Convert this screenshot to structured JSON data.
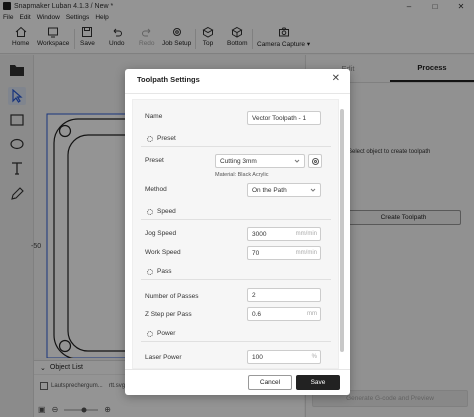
{
  "window": {
    "title": "Snapmaker Luban 4.1.3 / New *",
    "icon": "luban-logo-icon"
  },
  "menu": {
    "items": [
      "File",
      "Edit",
      "Window",
      "Settings",
      "Help"
    ]
  },
  "toolbar": {
    "home": "Home",
    "workspace": "Workspace",
    "save": "Save",
    "undo": "Undo",
    "redo": "Redo",
    "job_setup": "Job Setup",
    "top": "Top",
    "bottom": "Bottom",
    "camera_capture": "Camera Capture"
  },
  "canvas": {
    "axis_label": "-50"
  },
  "object_list": {
    "header": "Object List",
    "items": [
      {
        "name": "Lautsprechergum...",
        "ext": "rtt.svg"
      }
    ]
  },
  "right_panel": {
    "tabs": [
      "Edit",
      "Process"
    ],
    "active_tab": "Process",
    "select_hint": "Select object to create toolpath",
    "create_toolpath": "Create Toolpath",
    "generate_button": "Generate G-code and Preview"
  },
  "dialog": {
    "title": "Toolpath Settings",
    "name_label": "Name",
    "name_value": "Vector Toolpath - 1",
    "preset_section": "Preset",
    "preset_label": "Preset",
    "preset_value": "Cutting 3mm",
    "material_text": "Material: Black Acrylic",
    "method_label": "Method",
    "method_value": "On the Path",
    "speed_section": "Speed",
    "jog_speed_label": "Jog Speed",
    "jog_speed_value": "3000",
    "jog_speed_unit": "mm/min",
    "work_speed_label": "Work Speed",
    "work_speed_value": "70",
    "work_speed_unit": "mm/min",
    "pass_section": "Pass",
    "passes_label": "Number of Passes",
    "passes_value": "2",
    "step_label": "Z Step per Pass",
    "step_value": "0.6",
    "step_unit": "mm",
    "power_section": "Power",
    "laser_power_label": "Laser Power",
    "laser_power_value": "100",
    "laser_power_unit": "%",
    "cancel": "Cancel",
    "save": "Save"
  }
}
